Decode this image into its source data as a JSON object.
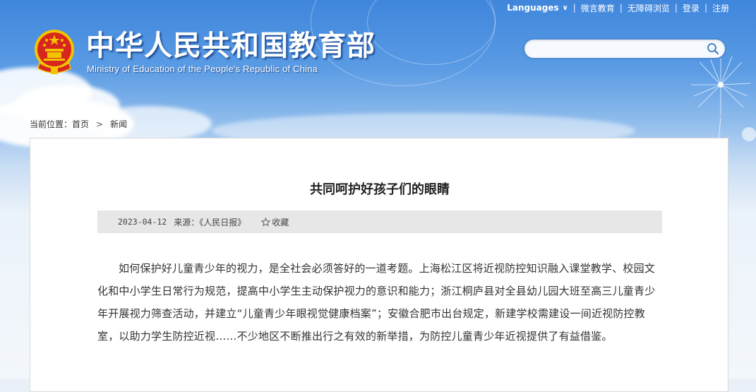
{
  "header": {
    "top_links": {
      "languages": "Languages",
      "weiyan": "微言教育",
      "accessibility": "无障碍浏览",
      "login": "登录",
      "register": "注册",
      "separator": "|"
    },
    "site_title": "中华人民共和国教育部",
    "site_subtitle": "Ministry of Education of the People's Republic of China",
    "search": {
      "placeholder": "",
      "value": ""
    }
  },
  "breadcrumb": {
    "prefix": "当前位置：",
    "home": "首页",
    "separator": ">",
    "current": "新闻"
  },
  "article": {
    "title": "共同呵护好孩子们的眼睛",
    "date": "2023-04-12",
    "source": "来源：《人民日报》",
    "favorite": "收藏",
    "body": "如何保护好儿童青少年的视力，是全社会必须答好的一道考题。上海松江区将近视防控知识融入课堂教学、校园文化和中小学生日常行为规范，提高中小学生主动保护视力的意识和能力；浙江桐庐县对全县幼儿园大班至高三儿童青少年开展视力筛查活动，并建立“儿童青少年眼视觉健康档案”；安徽合肥市出台规定，新建学校需建设一间近视防控教室，以助力学生防控近视……不少地区不断推出行之有效的新举措，为防控儿童青少年近视提供了有益借鉴。"
  },
  "colors": {
    "header_blue": "#3f86dc",
    "emblem_red": "#d7261e",
    "emblem_gold": "#f2c400"
  }
}
